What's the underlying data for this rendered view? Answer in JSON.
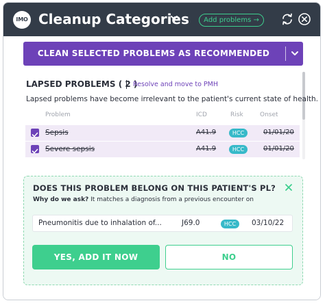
{
  "app": {
    "logo_text": "IMO",
    "title": "Cleanup Categories",
    "add_problems_label": "Add problems →"
  },
  "actions": {
    "clean_label": "CLEAN SELECTED PROBLEMS AS RECOMMENDED"
  },
  "section": {
    "title": "LAPSED PROBLEMS ( 2 )",
    "separator": "|",
    "resolve_label": "Resolve and move to PMH",
    "description": "Lapsed problems have become irrelevant to the patient's current state of health."
  },
  "columns": {
    "problem": "Problem",
    "icd": "ICD",
    "risk": "Risk",
    "onset": "Onset"
  },
  "problems": [
    {
      "name": "Sepsis",
      "icd": "A41.9",
      "risk": "HCC",
      "onset": "01/01/20",
      "checked": true
    },
    {
      "name": "Severe sepsis",
      "icd": "A41.9",
      "risk": "HCC",
      "onset": "01/01/20",
      "checked": true
    }
  ],
  "suggestion": {
    "question": "DOES THIS PROBLEM BELONG ON THIS PATIENT'S PL?",
    "why_label": "Why do we ask?",
    "why_text": "It matches a diagnosis from a previous encounter on",
    "diagnosis": {
      "name": "Pneumonitis due to inhalation of...",
      "icd": "J69.0",
      "risk": "HCC",
      "date": "03/10/22"
    },
    "yes_label": "YES, ADD IT NOW",
    "no_label": "NO"
  },
  "colors": {
    "titlebar": "#333c48",
    "purple": "#6d42b8",
    "green": "#3ecf8e",
    "teal_badge": "#37b9c9",
    "row_highlight": "#f1eaf7",
    "suggest_bg": "#edf9f3"
  },
  "icons": {
    "title_chevron": "chevron-down-icon",
    "refresh": "refresh-icon",
    "close": "close-icon",
    "clean_chevron": "chevron-down-icon",
    "checkbox": "checkbox-checked-icon"
  }
}
